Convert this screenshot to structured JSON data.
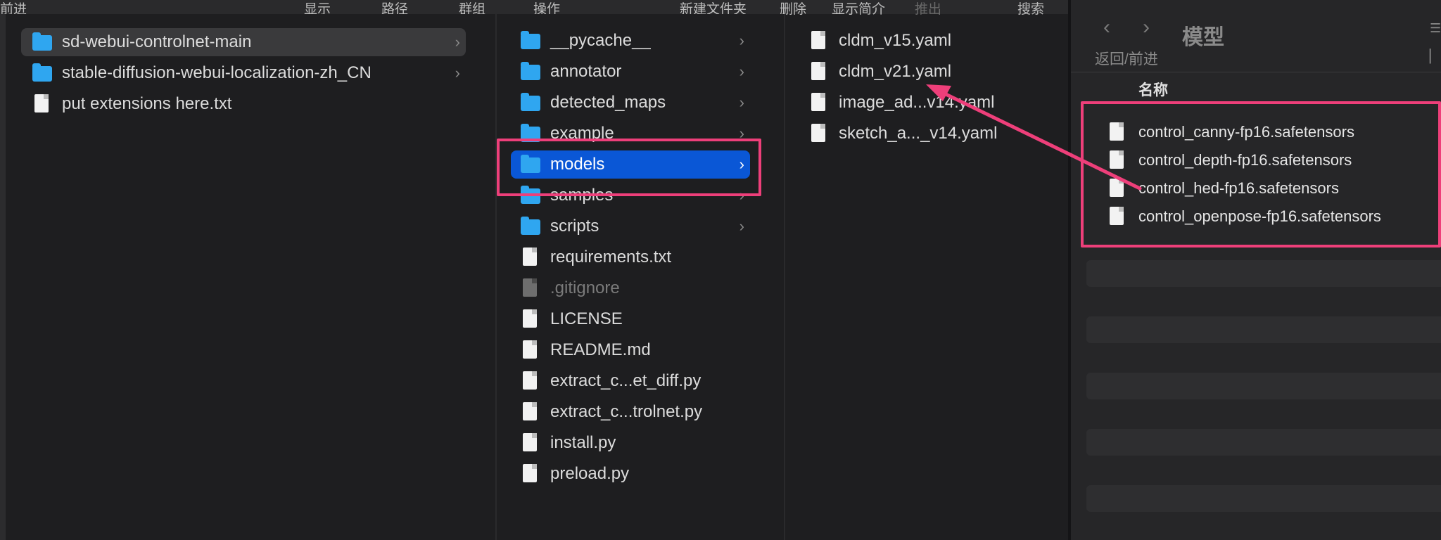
{
  "toolbar": {
    "items": [
      {
        "label": "前进",
        "dim": false
      },
      {
        "label": "显示",
        "dim": false
      },
      {
        "label": "路径",
        "dim": false
      },
      {
        "label": "群组",
        "dim": false
      },
      {
        "label": "操作",
        "dim": false
      },
      {
        "label": "新建文件夹",
        "dim": false
      },
      {
        "label": "删除",
        "dim": false
      },
      {
        "label": "显示简介",
        "dim": false
      },
      {
        "label": "推出",
        "dim": true
      },
      {
        "label": "搜索",
        "dim": false
      }
    ]
  },
  "column1": {
    "items": [
      {
        "label": "sd-webui-controlnet-main",
        "kind": "folder",
        "chevron": "›",
        "state": "selected-inactive"
      },
      {
        "label": "stable-diffusion-webui-localization-zh_CN",
        "kind": "folder",
        "chevron": "›",
        "state": ""
      },
      {
        "label": "put extensions here.txt",
        "kind": "text",
        "chevron": "",
        "state": ""
      }
    ]
  },
  "column2": {
    "items": [
      {
        "label": "__pycache__",
        "kind": "folder",
        "chevron": "›",
        "state": ""
      },
      {
        "label": "annotator",
        "kind": "folder",
        "chevron": "›",
        "state": ""
      },
      {
        "label": "detected_maps",
        "kind": "folder",
        "chevron": "›",
        "state": ""
      },
      {
        "label": "example",
        "kind": "folder",
        "chevron": "›",
        "state": ""
      },
      {
        "label": "models",
        "kind": "folder",
        "chevron": "›",
        "state": "selected"
      },
      {
        "label": "samples",
        "kind": "folder",
        "chevron": "›",
        "state": ""
      },
      {
        "label": "scripts",
        "kind": "folder",
        "chevron": "›",
        "state": ""
      },
      {
        "label": "requirements.txt",
        "kind": "text",
        "chevron": "",
        "state": ""
      },
      {
        "label": ".gitignore",
        "kind": "hidden",
        "chevron": "",
        "state": "dim"
      },
      {
        "label": "LICENSE",
        "kind": "doc",
        "chevron": "",
        "state": ""
      },
      {
        "label": "README.md",
        "kind": "md",
        "chevron": "",
        "state": ""
      },
      {
        "label": "extract_c...et_diff.py",
        "kind": "py",
        "chevron": "",
        "state": ""
      },
      {
        "label": "extract_c...trolnet.py",
        "kind": "py",
        "chevron": "",
        "state": ""
      },
      {
        "label": "install.py",
        "kind": "py",
        "chevron": "",
        "state": ""
      },
      {
        "label": "preload.py",
        "kind": "py",
        "chevron": "",
        "state": ""
      }
    ]
  },
  "column3": {
    "items": [
      {
        "label": "cldm_v15.yaml",
        "kind": "doc"
      },
      {
        "label": "cldm_v21.yaml",
        "kind": "doc"
      },
      {
        "label": "image_ad...v14.yaml",
        "kind": "doc"
      },
      {
        "label": "sketch_a..._v14.yaml",
        "kind": "doc"
      }
    ]
  },
  "right_window": {
    "back_icon": "chevron-left-icon",
    "forward_icon": "chevron-right-icon",
    "title": "模型",
    "nav_label": "返回/前进",
    "column_header": "名称",
    "files": [
      {
        "label": "control_canny-fp16.safetensors"
      },
      {
        "label": "control_depth-fp16.safetensors"
      },
      {
        "label": "control_hed-fp16.safetensors"
      },
      {
        "label": "control_openpose-fp16.safetensors"
      }
    ]
  },
  "annotations": {
    "highlight_color": "#ee3f7a",
    "selection_color": "#0a57d6",
    "folder_color": "#2fa6f0"
  }
}
